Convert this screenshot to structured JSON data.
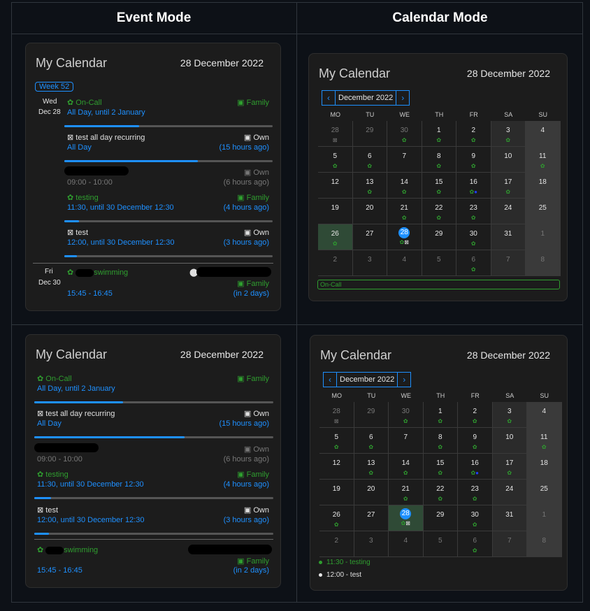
{
  "headers": {
    "event_mode": "Event Mode",
    "calendar_mode": "Calendar Mode"
  },
  "card": {
    "title": "My Calendar",
    "date": "28 December 2022"
  },
  "event_list": {
    "week_badge": "Week 52",
    "day1": {
      "weekday": "Wed",
      "date": "Dec 28"
    },
    "day2": {
      "weekday": "Fri",
      "date": "Dec 30"
    },
    "events": [
      {
        "title": "On-Call",
        "calendar": "Family",
        "time": "All Day, until 2 January",
        "relative": "",
        "progress": 0.36
      },
      {
        "title": "test all day recurring",
        "calendar": "Own",
        "time": "All Day",
        "relative": "(15 hours ago)",
        "progress": 0.64
      },
      {
        "title": "",
        "calendar": "Own",
        "time": "09:00 - 10:00",
        "relative": "(6 hours ago)",
        "progress": 0
      },
      {
        "title": "testing",
        "calendar": "Family",
        "time": "11:30, until 30 December 12:30",
        "relative": "(4 hours ago)",
        "progress": 0.07
      },
      {
        "title": "test",
        "calendar": "Own",
        "time": "12:00, until 30 December 12:30",
        "relative": "(3 hours ago)",
        "progress": 0.06
      },
      {
        "title": "swimming",
        "calendar": "Family",
        "time": "15:45 - 16:45",
        "relative": "(in 2 days)",
        "progress": 0
      }
    ]
  },
  "calendar": {
    "month_label": "December 2022",
    "prev": "‹",
    "next": "›",
    "weekdays": [
      "MO",
      "TU",
      "WE",
      "TH",
      "FR",
      "SA",
      "SU"
    ],
    "weeks": [
      [
        "28",
        "29",
        "30",
        "1",
        "2",
        "3",
        "4"
      ],
      [
        "5",
        "6",
        "7",
        "8",
        "9",
        "10",
        "11"
      ],
      [
        "12",
        "13",
        "14",
        "15",
        "16",
        "17",
        "18"
      ],
      [
        "19",
        "20",
        "21",
        "22",
        "23",
        "24",
        "25"
      ],
      [
        "26",
        "27",
        "28",
        "29",
        "30",
        "31",
        "1"
      ],
      [
        "2",
        "3",
        "4",
        "5",
        "6",
        "7",
        "8"
      ]
    ],
    "legend_oncall": "On-Call",
    "day_events": [
      {
        "label": "11:30 - testing",
        "color": "#2f9e2f"
      },
      {
        "label": "12:00 - test",
        "color": "#e6e6e6"
      }
    ]
  },
  "icons": {
    "family": "calendar-icon",
    "own": "calendar-icon",
    "event": "flower-icon",
    "recurring": "recurring-icon",
    "location": "pin-icon"
  },
  "colors": {
    "accent": "#1e90ff",
    "family": "#2f9e2f",
    "background": "#1c1c1c"
  }
}
